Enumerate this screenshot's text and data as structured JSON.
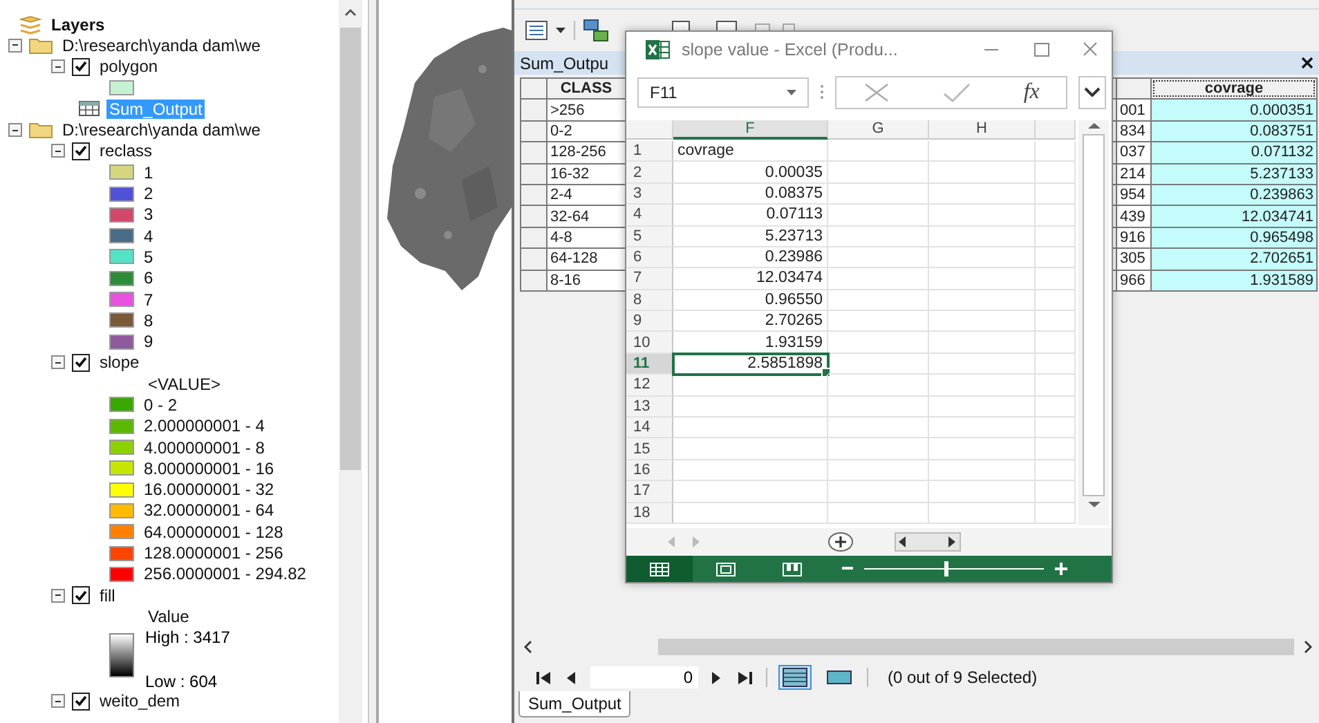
{
  "toc": {
    "title": "Layers",
    "groups": [
      {
        "path": "D:\\research\\yanda dam\\we",
        "expanded": true,
        "items": [
          {
            "kind": "layer",
            "name": "polygon",
            "checked": true,
            "expanded": true,
            "selected": false,
            "legend": [
              {
                "kind": "swatch",
                "color": "#c4f2d3"
              }
            ]
          },
          {
            "kind": "table",
            "name": "Sum_Output",
            "selected": true
          }
        ]
      },
      {
        "path": "D:\\research\\yanda dam\\we",
        "expanded": true,
        "items": [
          {
            "kind": "layer",
            "name": "reclass",
            "checked": true,
            "expanded": true,
            "selected": false,
            "legend": [
              {
                "kind": "swatch",
                "label": "1",
                "color": "#d6d67e"
              },
              {
                "kind": "swatch",
                "label": "2",
                "color": "#5050d8"
              },
              {
                "kind": "swatch",
                "label": "3",
                "color": "#d2486a"
              },
              {
                "kind": "swatch",
                "label": "4",
                "color": "#4a6c86"
              },
              {
                "kind": "swatch",
                "label": "5",
                "color": "#52e3c8"
              },
              {
                "kind": "swatch",
                "label": "6",
                "color": "#2e8b3a"
              },
              {
                "kind": "swatch",
                "label": "7",
                "color": "#e852e0"
              },
              {
                "kind": "swatch",
                "label": "8",
                "color": "#7b5a3a"
              },
              {
                "kind": "swatch",
                "label": "9",
                "color": "#8e5a9d"
              }
            ]
          },
          {
            "kind": "layer",
            "name": "slope",
            "checked": true,
            "expanded": true,
            "selected": false,
            "legend": [
              {
                "kind": "heading",
                "label": "<VALUE>"
              },
              {
                "kind": "swatch",
                "label": "0 - 2",
                "color": "#38a800"
              },
              {
                "kind": "swatch",
                "label": "2.000000001 - 4",
                "color": "#5cb800"
              },
              {
                "kind": "swatch",
                "label": "4.000000001 - 8",
                "color": "#8ed100"
              },
              {
                "kind": "swatch",
                "label": "8.000000001 - 16",
                "color": "#c6e600"
              },
              {
                "kind": "swatch",
                "label": "16.00000001 - 32",
                "color": "#ffff00"
              },
              {
                "kind": "swatch",
                "label": "32.00000001 - 64",
                "color": "#ffbb00"
              },
              {
                "kind": "swatch",
                "label": "64.00000001 - 128",
                "color": "#ff8000"
              },
              {
                "kind": "swatch",
                "label": "128.0000001 - 256",
                "color": "#ff4400"
              },
              {
                "kind": "swatch",
                "label": "256.0000001 - 294.82",
                "color": "#ff0000"
              }
            ]
          },
          {
            "kind": "layer",
            "name": "fill",
            "checked": true,
            "expanded": true,
            "selected": false,
            "legend": [
              {
                "kind": "heading",
                "label": "Value"
              },
              {
                "kind": "ramp",
                "high": "High : 3417",
                "low": "Low : 604"
              }
            ]
          },
          {
            "kind": "layer",
            "name": "weito_dem",
            "checked": true,
            "expanded": true,
            "selected": false
          }
        ]
      }
    ]
  },
  "table_window": {
    "title": "Sum_Outpu",
    "columns": [
      "CLASS",
      "covrage"
    ],
    "rows": [
      {
        "class": ">256",
        "column_3": "001",
        "covrage": "0.000351"
      },
      {
        "class": "0-2",
        "column_3": "834",
        "covrage": "0.083751"
      },
      {
        "class": "128-256",
        "column_3": "037",
        "covrage": "0.071132"
      },
      {
        "class": "16-32",
        "column_3": "214",
        "covrage": "5.237133"
      },
      {
        "class": "2-4",
        "column_3": "954",
        "covrage": "0.239863"
      },
      {
        "class": "32-64",
        "column_3": "439",
        "covrage": "12.034741"
      },
      {
        "class": "4-8",
        "column_3": "916",
        "covrage": "0.965498"
      },
      {
        "class": "64-128",
        "column_3": "305",
        "covrage": "2.702651"
      },
      {
        "class": "8-16",
        "column_3": "966",
        "covrage": "1.931589"
      }
    ],
    "nav": {
      "record": "0",
      "views": [
        {
          "kind": "all",
          "selected": true
        },
        {
          "kind": "selected",
          "selected": false
        }
      ],
      "status": "(0 out of 9 Selected)"
    },
    "tab": "Sum_Output"
  },
  "excel": {
    "title": "slope value - Excel (Produ...",
    "name_box": "F11",
    "function_label": "fx",
    "columns": [
      {
        "label": "F",
        "selected": true
      },
      {
        "label": "G",
        "selected": false
      },
      {
        "label": "H",
        "selected": false
      }
    ],
    "rows": [
      {
        "number": "1",
        "kind": "text",
        "value": "covrage",
        "selected": false
      },
      {
        "number": "2",
        "kind": "number",
        "value": "0.00035",
        "selected": false
      },
      {
        "number": "3",
        "kind": "number",
        "value": "0.08375",
        "selected": false
      },
      {
        "number": "4",
        "kind": "number",
        "value": "0.07113",
        "selected": false
      },
      {
        "number": "5",
        "kind": "number",
        "value": "5.23713",
        "selected": false
      },
      {
        "number": "6",
        "kind": "number",
        "value": "0.23986",
        "selected": false
      },
      {
        "number": "7",
        "kind": "number",
        "value": "12.03474",
        "selected": false
      },
      {
        "number": "8",
        "kind": "number",
        "value": "0.96550",
        "selected": false
      },
      {
        "number": "9",
        "kind": "number",
        "value": "2.70265",
        "selected": false
      },
      {
        "number": "10",
        "kind": "number",
        "value": "1.93159",
        "selected": false
      },
      {
        "number": "11",
        "kind": "number",
        "value": "2.5851898",
        "selected": true
      },
      {
        "number": "12",
        "selected": false
      },
      {
        "number": "13",
        "selected": false
      },
      {
        "number": "14",
        "selected": false
      },
      {
        "number": "15",
        "selected": false
      },
      {
        "number": "16",
        "selected": false
      },
      {
        "number": "17",
        "selected": false
      },
      {
        "number": "18",
        "selected": false
      }
    ],
    "views": [
      {
        "kind": "normal",
        "selected": true
      },
      {
        "kind": "layout",
        "selected": false
      },
      {
        "kind": "break",
        "selected": false
      }
    ],
    "zoom": {
      "level": 0.45
    }
  }
}
